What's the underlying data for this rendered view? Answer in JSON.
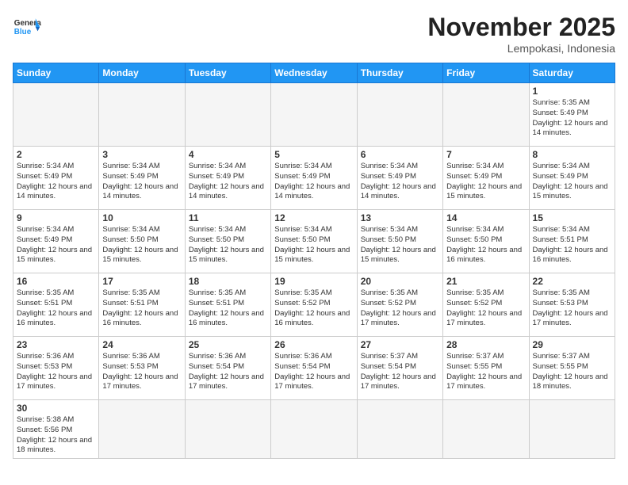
{
  "header": {
    "logo_general": "General",
    "logo_blue": "Blue",
    "title": "November 2025",
    "location": "Lempokasi, Indonesia"
  },
  "days_of_week": [
    "Sunday",
    "Monday",
    "Tuesday",
    "Wednesday",
    "Thursday",
    "Friday",
    "Saturday"
  ],
  "weeks": [
    [
      {
        "day": "",
        "info": ""
      },
      {
        "day": "",
        "info": ""
      },
      {
        "day": "",
        "info": ""
      },
      {
        "day": "",
        "info": ""
      },
      {
        "day": "",
        "info": ""
      },
      {
        "day": "",
        "info": ""
      },
      {
        "day": "1",
        "info": "Sunrise: 5:35 AM\nSunset: 5:49 PM\nDaylight: 12 hours and 14 minutes."
      }
    ],
    [
      {
        "day": "2",
        "info": "Sunrise: 5:34 AM\nSunset: 5:49 PM\nDaylight: 12 hours and 14 minutes."
      },
      {
        "day": "3",
        "info": "Sunrise: 5:34 AM\nSunset: 5:49 PM\nDaylight: 12 hours and 14 minutes."
      },
      {
        "day": "4",
        "info": "Sunrise: 5:34 AM\nSunset: 5:49 PM\nDaylight: 12 hours and 14 minutes."
      },
      {
        "day": "5",
        "info": "Sunrise: 5:34 AM\nSunset: 5:49 PM\nDaylight: 12 hours and 14 minutes."
      },
      {
        "day": "6",
        "info": "Sunrise: 5:34 AM\nSunset: 5:49 PM\nDaylight: 12 hours and 14 minutes."
      },
      {
        "day": "7",
        "info": "Sunrise: 5:34 AM\nSunset: 5:49 PM\nDaylight: 12 hours and 15 minutes."
      },
      {
        "day": "8",
        "info": "Sunrise: 5:34 AM\nSunset: 5:49 PM\nDaylight: 12 hours and 15 minutes."
      }
    ],
    [
      {
        "day": "9",
        "info": "Sunrise: 5:34 AM\nSunset: 5:49 PM\nDaylight: 12 hours and 15 minutes."
      },
      {
        "day": "10",
        "info": "Sunrise: 5:34 AM\nSunset: 5:50 PM\nDaylight: 12 hours and 15 minutes."
      },
      {
        "day": "11",
        "info": "Sunrise: 5:34 AM\nSunset: 5:50 PM\nDaylight: 12 hours and 15 minutes."
      },
      {
        "day": "12",
        "info": "Sunrise: 5:34 AM\nSunset: 5:50 PM\nDaylight: 12 hours and 15 minutes."
      },
      {
        "day": "13",
        "info": "Sunrise: 5:34 AM\nSunset: 5:50 PM\nDaylight: 12 hours and 15 minutes."
      },
      {
        "day": "14",
        "info": "Sunrise: 5:34 AM\nSunset: 5:50 PM\nDaylight: 12 hours and 16 minutes."
      },
      {
        "day": "15",
        "info": "Sunrise: 5:34 AM\nSunset: 5:51 PM\nDaylight: 12 hours and 16 minutes."
      }
    ],
    [
      {
        "day": "16",
        "info": "Sunrise: 5:35 AM\nSunset: 5:51 PM\nDaylight: 12 hours and 16 minutes."
      },
      {
        "day": "17",
        "info": "Sunrise: 5:35 AM\nSunset: 5:51 PM\nDaylight: 12 hours and 16 minutes."
      },
      {
        "day": "18",
        "info": "Sunrise: 5:35 AM\nSunset: 5:51 PM\nDaylight: 12 hours and 16 minutes."
      },
      {
        "day": "19",
        "info": "Sunrise: 5:35 AM\nSunset: 5:52 PM\nDaylight: 12 hours and 16 minutes."
      },
      {
        "day": "20",
        "info": "Sunrise: 5:35 AM\nSunset: 5:52 PM\nDaylight: 12 hours and 17 minutes."
      },
      {
        "day": "21",
        "info": "Sunrise: 5:35 AM\nSunset: 5:52 PM\nDaylight: 12 hours and 17 minutes."
      },
      {
        "day": "22",
        "info": "Sunrise: 5:35 AM\nSunset: 5:53 PM\nDaylight: 12 hours and 17 minutes."
      }
    ],
    [
      {
        "day": "23",
        "info": "Sunrise: 5:36 AM\nSunset: 5:53 PM\nDaylight: 12 hours and 17 minutes."
      },
      {
        "day": "24",
        "info": "Sunrise: 5:36 AM\nSunset: 5:53 PM\nDaylight: 12 hours and 17 minutes."
      },
      {
        "day": "25",
        "info": "Sunrise: 5:36 AM\nSunset: 5:54 PM\nDaylight: 12 hours and 17 minutes."
      },
      {
        "day": "26",
        "info": "Sunrise: 5:36 AM\nSunset: 5:54 PM\nDaylight: 12 hours and 17 minutes."
      },
      {
        "day": "27",
        "info": "Sunrise: 5:37 AM\nSunset: 5:54 PM\nDaylight: 12 hours and 17 minutes."
      },
      {
        "day": "28",
        "info": "Sunrise: 5:37 AM\nSunset: 5:55 PM\nDaylight: 12 hours and 17 minutes."
      },
      {
        "day": "29",
        "info": "Sunrise: 5:37 AM\nSunset: 5:55 PM\nDaylight: 12 hours and 18 minutes."
      }
    ],
    [
      {
        "day": "30",
        "info": "Sunrise: 5:38 AM\nSunset: 5:56 PM\nDaylight: 12 hours and 18 minutes."
      },
      {
        "day": "",
        "info": ""
      },
      {
        "day": "",
        "info": ""
      },
      {
        "day": "",
        "info": ""
      },
      {
        "day": "",
        "info": ""
      },
      {
        "day": "",
        "info": ""
      },
      {
        "day": "",
        "info": ""
      }
    ]
  ]
}
